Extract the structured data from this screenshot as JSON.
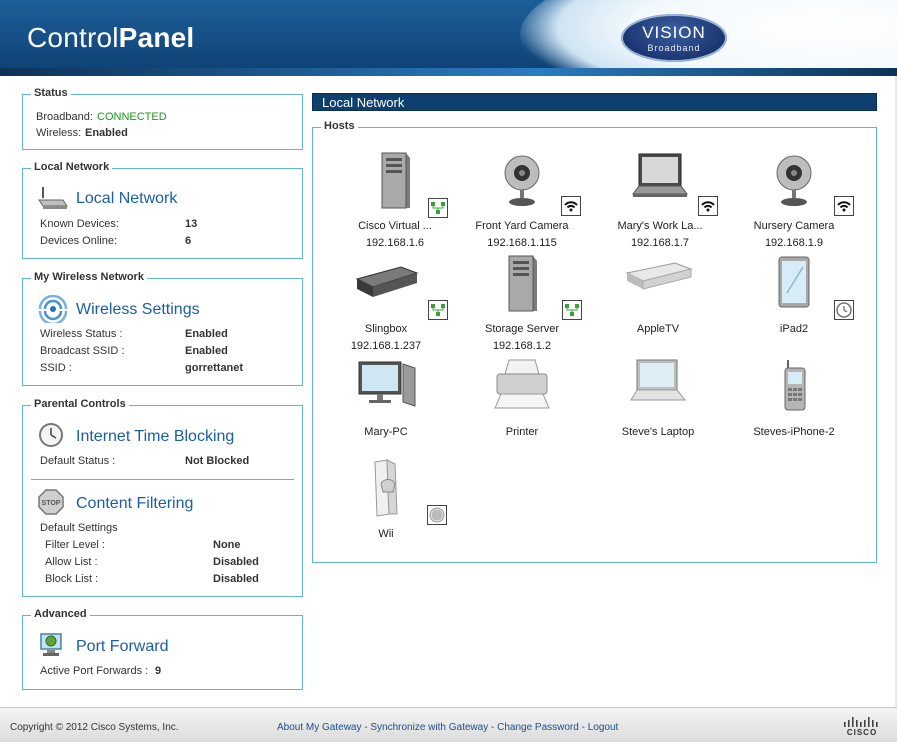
{
  "header": {
    "title_light": "Control",
    "title_bold": "Panel",
    "logo_top": "VISION",
    "logo_bottom": "Broadband"
  },
  "status": {
    "legend": "Status",
    "broadband_label": "Broadband:",
    "broadband_value": "CONNECTED",
    "broadband_color": "#1a9a1a",
    "wireless_label": "Wireless:",
    "wireless_value": "Enabled"
  },
  "local_network": {
    "legend": "Local Network",
    "title": "Local Network",
    "known_label": "Known Devices:",
    "known_value": "13",
    "online_label": "Devices Online:",
    "online_value": "6"
  },
  "wireless": {
    "legend": "My Wireless Network",
    "title": "Wireless Settings",
    "status_label": "Wireless Status :",
    "status_value": "Enabled",
    "broadcast_label": "Broadcast SSID :",
    "broadcast_value": "Enabled",
    "ssid_label": "SSID :",
    "ssid_value": "gorrettanet"
  },
  "parental": {
    "legend": "Parental Controls",
    "time_title": "Internet Time Blocking",
    "default_status_label": "Default Status :",
    "default_status_value": "Not Blocked",
    "filter_title": "Content Filtering",
    "default_settings": "Default Settings",
    "filter_level_label": "Filter Level :",
    "filter_level_value": "None",
    "allow_label": "Allow List :",
    "allow_value": "Disabled",
    "block_label": "Block List :",
    "block_value": "Disabled"
  },
  "advanced": {
    "legend": "Advanced",
    "title": "Port Forward",
    "active_label": "Active Port Forwards :",
    "active_value": "9"
  },
  "main": {
    "header": "Local Network",
    "hosts_legend": "Hosts",
    "hosts": [
      {
        "name": "Cisco Virtual ...",
        "ip": "192.168.1.6",
        "icon": "server-icon",
        "badge": "wired-icon"
      },
      {
        "name": "Front Yard Camera",
        "ip": "192.168.1.115",
        "icon": "webcam-icon",
        "badge": "wifi-icon"
      },
      {
        "name": "Mary's Work La...",
        "ip": "192.168.1.7",
        "icon": "laptop-icon",
        "badge": "wifi-icon"
      },
      {
        "name": "Nursery Camera",
        "ip": "192.168.1.9",
        "icon": "webcam-icon",
        "badge": "wifi-icon"
      },
      {
        "name": "Slingbox",
        "ip": "192.168.1.237",
        "icon": "settop-box-icon",
        "badge": "wired-icon"
      },
      {
        "name": "Storage Server",
        "ip": "192.168.1.2",
        "icon": "server-icon",
        "badge": "wired-icon"
      },
      {
        "name": "AppleTV",
        "ip": "",
        "icon": "settop-box-icon",
        "badge": ""
      },
      {
        "name": "iPad2",
        "ip": "",
        "icon": "tablet-icon",
        "badge": "clock-icon"
      },
      {
        "name": "Mary-PC",
        "ip": "",
        "icon": "desktop-icon",
        "badge": ""
      },
      {
        "name": "Printer",
        "ip": "",
        "icon": "printer-icon",
        "badge": ""
      },
      {
        "name": "Steve's Laptop",
        "ip": "",
        "icon": "laptop-icon",
        "badge": ""
      },
      {
        "name": "Steves-iPhone-2",
        "ip": "",
        "icon": "phone-icon",
        "badge": ""
      },
      {
        "name": "Wii",
        "ip": "",
        "icon": "game-console-icon",
        "badge": "blocked-icon"
      }
    ]
  },
  "footer": {
    "copyright": "Copyright © 2012 Cisco Systems, Inc.",
    "link_about": "About My Gateway",
    "link_sync": "Synchronize with Gateway",
    "link_password": "Change Password",
    "link_logout": "Logout",
    "separator": " - ",
    "cisco": "CISCO"
  },
  "colors": {
    "accent": "#1a5fa6",
    "panel_border": "#5fb3dd",
    "header_bar": "#0e3f6f"
  }
}
